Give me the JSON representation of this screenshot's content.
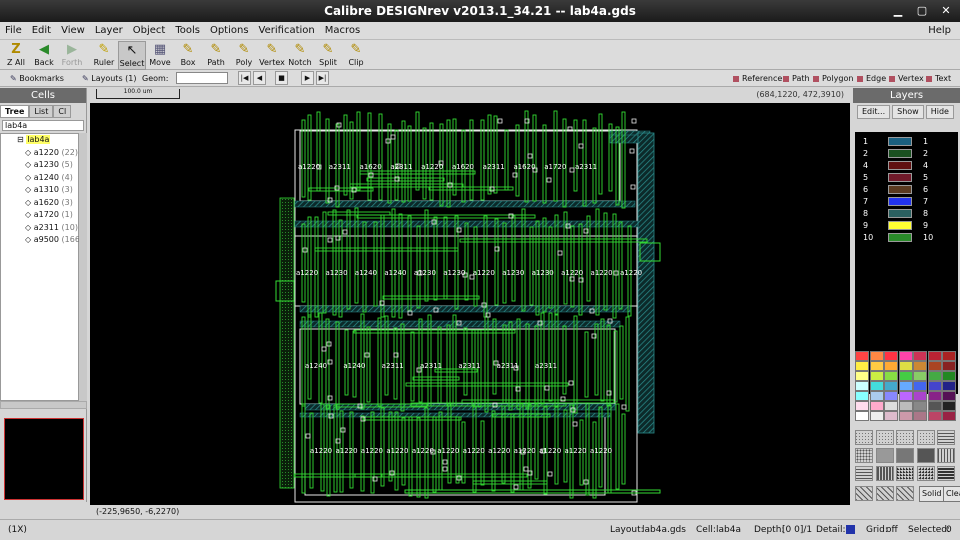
{
  "window": {
    "title": "Calibre DESIGNrev v2013.1_34.21  --  lab4a.gds"
  },
  "menu": [
    "File",
    "Edit",
    "View",
    "Layer",
    "Object",
    "Tools",
    "Options",
    "Verification",
    "Macros"
  ],
  "menu_help": "Help",
  "toolbar": [
    {
      "label": "Z All",
      "icon": "zoom-all-icon",
      "glyph": "Z"
    },
    {
      "label": "Back",
      "icon": "back-arrow-icon",
      "glyph": "◀"
    },
    {
      "label": "Forth",
      "icon": "forth-arrow-icon",
      "glyph": "▶"
    },
    {
      "label": "Ruler",
      "icon": "ruler-icon",
      "glyph": "✎"
    },
    {
      "label": "Select",
      "icon": "select-arrow-icon",
      "glyph": "↖"
    },
    {
      "label": "Move",
      "icon": "move-icon",
      "glyph": "▦"
    },
    {
      "label": "Box",
      "icon": "box-icon",
      "glyph": "✎"
    },
    {
      "label": "Path",
      "icon": "path-icon",
      "glyph": "✎"
    },
    {
      "label": "Poly",
      "icon": "poly-icon",
      "glyph": "✎"
    },
    {
      "label": "Vertex",
      "icon": "vertex-icon",
      "glyph": "✎"
    },
    {
      "label": "Notch",
      "icon": "notch-icon",
      "glyph": "✎"
    },
    {
      "label": "Split",
      "icon": "split-icon",
      "glyph": "✎"
    },
    {
      "label": "Clip",
      "icon": "clip-icon",
      "glyph": "✎"
    }
  ],
  "toolbar2": {
    "bookmarks": "Bookmarks",
    "layouts": "Layouts (1)",
    "geom": "Geom:",
    "legend": [
      "Reference",
      "Path",
      "Polygon",
      "Edge",
      "Vertex",
      "Text"
    ]
  },
  "cells_panel": {
    "title": "Cells",
    "tabs": [
      "Tree",
      "List",
      "Cl"
    ],
    "filter_value": "lab4a",
    "root": "lab4a",
    "children": [
      {
        "name": "a1220",
        "count": "(22)"
      },
      {
        "name": "a1230",
        "count": "(5)"
      },
      {
        "name": "a1240",
        "count": "(4)"
      },
      {
        "name": "a1310",
        "count": "(3)"
      },
      {
        "name": "a1620",
        "count": "(3)"
      },
      {
        "name": "a1720",
        "count": "(1)"
      },
      {
        "name": "a2311",
        "count": "(10)"
      },
      {
        "name": "a9500",
        "count": "(166)"
      }
    ]
  },
  "canvas": {
    "scale_label": "100.0 um",
    "cursor_coord": "(684,1220, 472,3910)",
    "bottom_coord": "(-225,9650, -6,2270)",
    "row1_labels": [
      "a1220",
      "a2311",
      "a1620",
      "a2311",
      "a1220",
      "a1620",
      "a2311",
      "a1620",
      "a1720",
      "a2311"
    ],
    "row2_labels": [
      "a1220",
      "a1230",
      "a1240",
      "a1240",
      "a1230",
      "a1230",
      "a1220",
      "a1230",
      "a1230",
      "a1220",
      "a1220",
      "a1220"
    ],
    "row3_labels": [
      "a1240",
      "a1240",
      "a2311",
      "a2311",
      "a2311",
      "a2311",
      "a2311"
    ],
    "row4_labels": [
      "a1220",
      "a1220",
      "a1220",
      "a1220",
      "a1220",
      "a1220",
      "a1220",
      "a1220",
      "a1220",
      "a1220",
      "a1220",
      "a1220"
    ]
  },
  "layers_panel": {
    "title": "Layers",
    "buttons": [
      "Edit...",
      "Show",
      "Hide"
    ],
    "layers": [
      {
        "num": "1",
        "name": "1",
        "color": "#1a6080"
      },
      {
        "num": "2",
        "name": "2",
        "color": "#1a5020"
      },
      {
        "num": "4",
        "name": "4",
        "color": "#601010"
      },
      {
        "num": "5",
        "name": "5",
        "color": "#701a2a"
      },
      {
        "num": "6",
        "name": "6",
        "color": "#5a3a20"
      },
      {
        "num": "7",
        "name": "7",
        "color": "#2233ee"
      },
      {
        "num": "8",
        "name": "8",
        "color": "#2a6060"
      },
      {
        "num": "9",
        "name": "9",
        "color": "#ffff33"
      },
      {
        "num": "10",
        "name": "10",
        "color": "#2a8a2a"
      }
    ],
    "solid_label": "Solid",
    "clear_label": "Clear"
  },
  "status": {
    "zoom": "(1X)",
    "layout_label": "Layout:",
    "layout_value": "lab4a.gds",
    "cell_label": "Cell:",
    "cell_value": "lab4a",
    "depth_label": "Depth:",
    "depth_value": "[0 0]/1",
    "detail_label": "Detail:",
    "grid_label": "Grid:",
    "grid_value": "off",
    "selected_label": "Selected:",
    "selected_value": "0"
  },
  "colors": {
    "accent_green": "#33ff33",
    "teal_fill": "#2a7a7a",
    "highlight": "#ffff66"
  }
}
